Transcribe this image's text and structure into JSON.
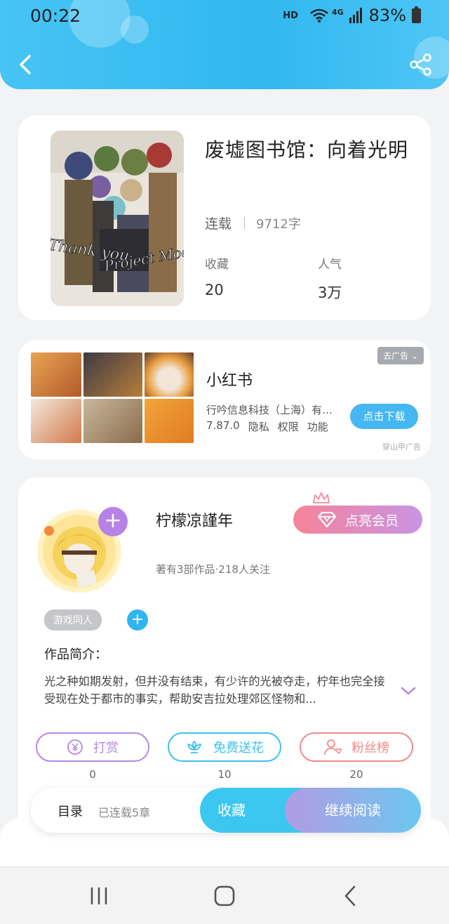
{
  "status_bar": {
    "time": "00:22",
    "hd": "HD",
    "network": "4G",
    "battery": "83%"
  },
  "header": {
    "back_icon": "chevron-left-icon",
    "share_icon": "share-icon"
  },
  "book": {
    "title": "废墟图书馆：向着光明",
    "status": "连载",
    "word_count": "9712字",
    "favorites_label": "收藏",
    "favorites_value": "20",
    "popularity_label": "人气",
    "popularity_value": "3万"
  },
  "ad": {
    "remove_ad": "去广告",
    "app_name": "小红书",
    "company": "行吟信息科技（上海）有限公司",
    "version": "7.87.0",
    "privacy": "隐私",
    "permissions": "权限",
    "features": "功能",
    "download": "点击下载",
    "source": "穿山甲广告"
  },
  "author": {
    "name": "柠檬凉謹年",
    "stats": "著有3部作品·218人关注",
    "vip_button": "点亮会员",
    "tag": "游戏同人",
    "intro_label": "作品简介：",
    "intro_text": "光之种如期发射，但并没有结束，有少许的光被夺走，柠年也完全接受现在处于都市的事实，帮助安吉拉处理郊区怪物和..."
  },
  "actions": [
    {
      "label": "打赏",
      "count": "0",
      "icon": "yen-coin-icon",
      "color": "#b38be3"
    },
    {
      "label": "免费送花",
      "count": "10",
      "icon": "flower-icon",
      "color": "#3cc2ef"
    },
    {
      "label": "粉丝榜",
      "count": "20",
      "icon": "fan-user-icon",
      "color": "#f08a8a"
    }
  ],
  "bottom_bar": {
    "toc": "目录",
    "chapters": "已连载5章",
    "favorite": "收藏",
    "continue": "继续阅读"
  },
  "colors": {
    "header_blue": "#3dbff2",
    "accent_purple": "#b782e6",
    "vip_pink": "#f58399"
  }
}
